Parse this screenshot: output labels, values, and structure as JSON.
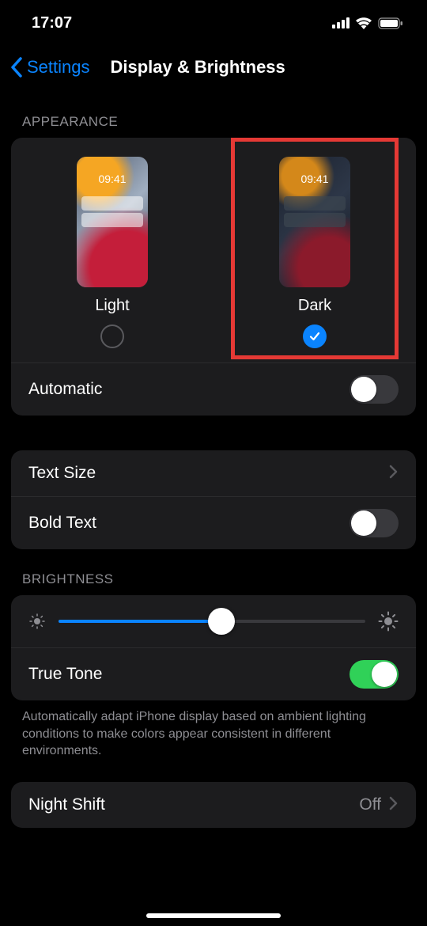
{
  "status": {
    "time": "17:07"
  },
  "nav": {
    "back_label": "Settings",
    "title": "Display & Brightness"
  },
  "appearance": {
    "header": "Appearance",
    "preview_time": "09:41",
    "light_label": "Light",
    "dark_label": "Dark",
    "selected": "dark",
    "automatic_label": "Automatic",
    "automatic_on": false
  },
  "text": {
    "size_label": "Text Size",
    "bold_label": "Bold Text",
    "bold_on": false
  },
  "brightness": {
    "header": "Brightness",
    "value_pct": 53,
    "true_tone_label": "True Tone",
    "true_tone_on": true,
    "footer": "Automatically adapt iPhone display based on ambient lighting conditions to make colors appear consistent in different environments."
  },
  "night_shift": {
    "label": "Night Shift",
    "value": "Off"
  }
}
